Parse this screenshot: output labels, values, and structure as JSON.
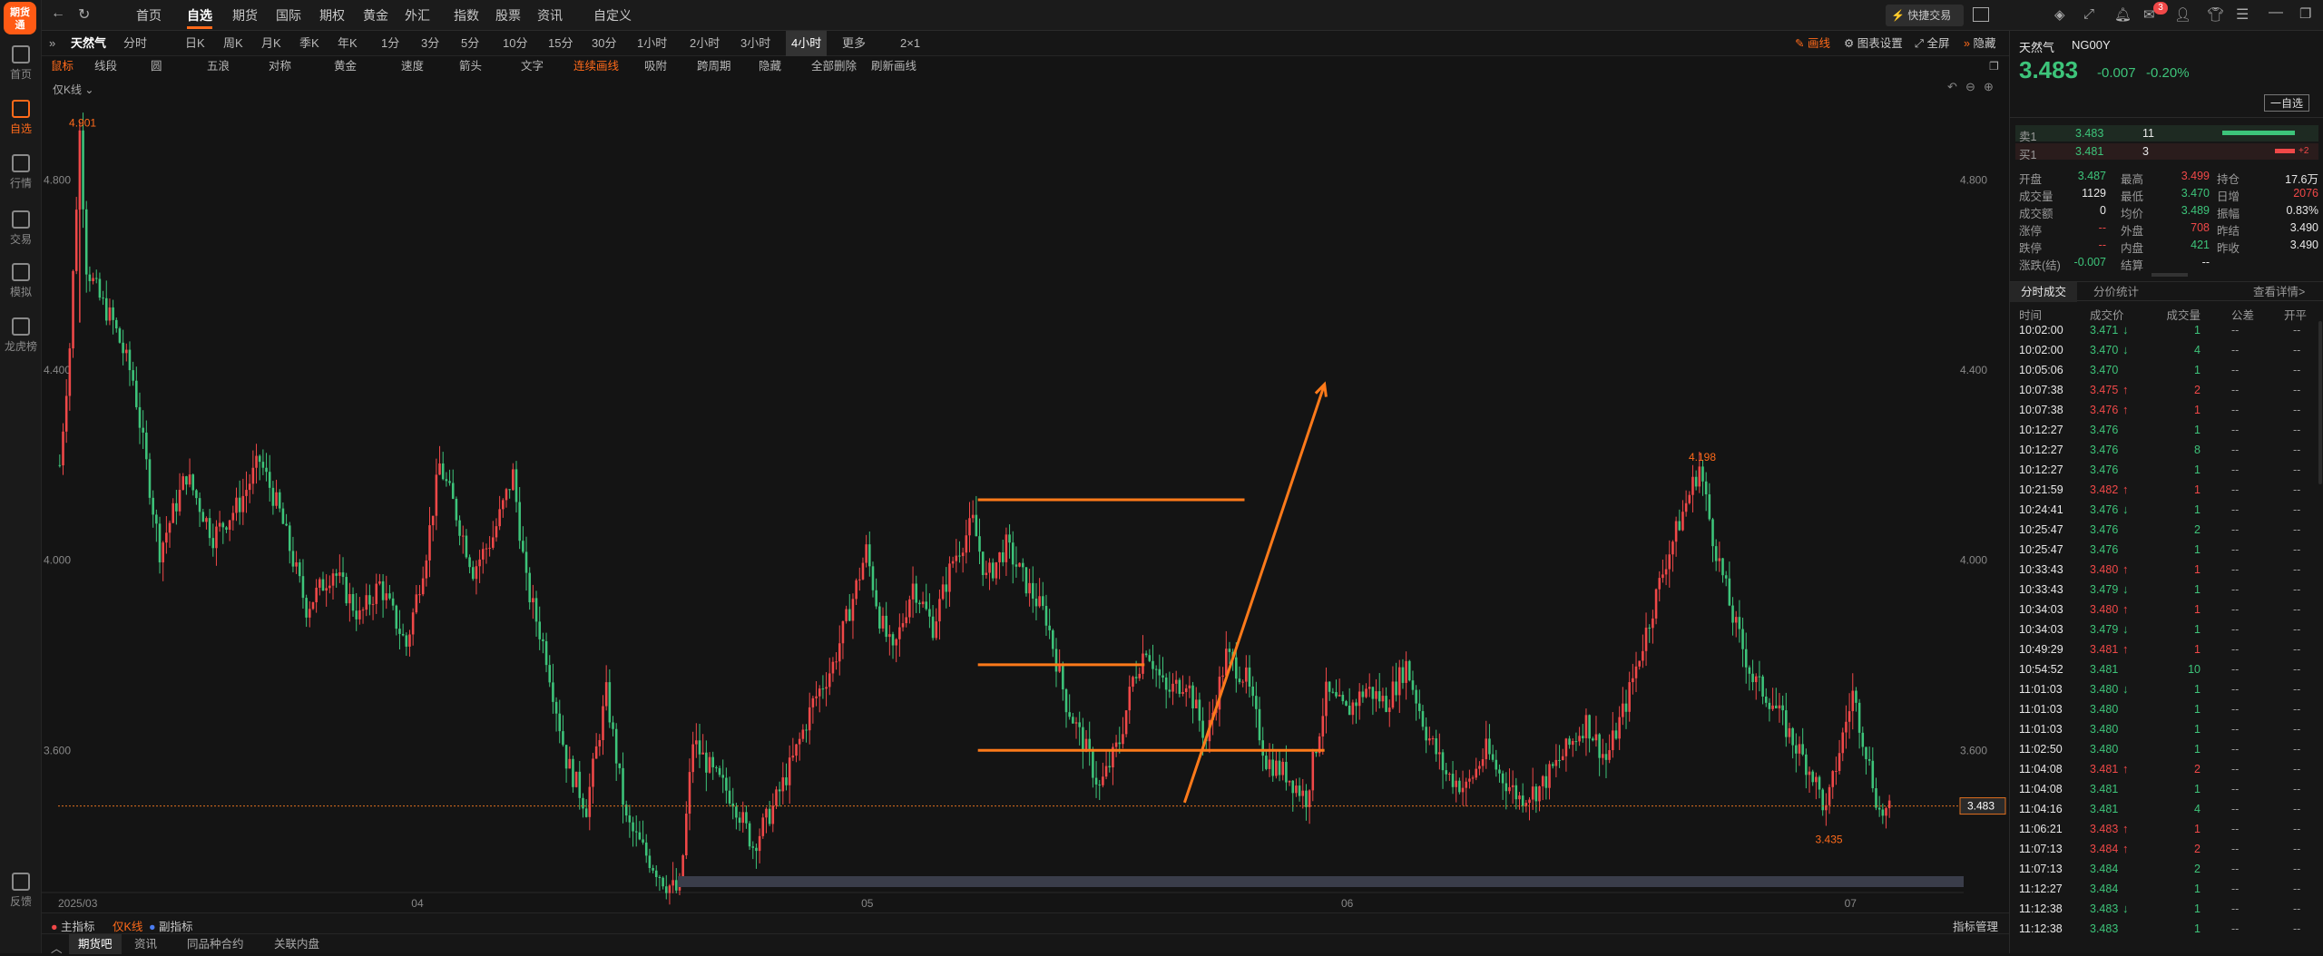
{
  "app": {
    "logo_text": "期货\n通"
  },
  "leftbar": [
    {
      "label": "首页",
      "icon": "grid-icon",
      "active": false
    },
    {
      "label": "自选",
      "icon": "briefcase-icon",
      "active": true
    },
    {
      "label": "行情",
      "icon": "chart-icon",
      "active": false
    },
    {
      "label": "交易",
      "icon": "yen-icon",
      "active": false
    },
    {
      "label": "模拟",
      "icon": "gamepad-icon",
      "active": false
    },
    {
      "label": "龙虎榜",
      "icon": "database-icon",
      "active": false
    },
    {
      "label": "反馈",
      "icon": "feedback-icon",
      "active": false
    }
  ],
  "nav": [
    "首页",
    "自选",
    "期货",
    "国际",
    "期权",
    "黄金",
    "外汇",
    "指数",
    "股票",
    "资讯",
    "自定义"
  ],
  "nav_active": 1,
  "toolbar_right": {
    "quick_trade": "快捷交易",
    "mail_badge": "3"
  },
  "symbol_tab": "天然气",
  "periods": [
    "分时",
    "日K",
    "周K",
    "月K",
    "季K",
    "年K",
    "1分",
    "3分",
    "5分",
    "10分",
    "15分",
    "30分",
    "1小时",
    "2小时",
    "3小时",
    "4小时",
    "更多",
    "2×1"
  ],
  "period_active": "4小时",
  "period_right": {
    "draw": "画线",
    "chart_settings": "图表设置",
    "fullscreen": "全屏",
    "hide": "隐藏"
  },
  "draw_tools": [
    "鼠标",
    "线段",
    "圆",
    "五浪",
    "对称",
    "黄金",
    "速度",
    "箭头",
    "文字",
    "连续画线",
    "吸附",
    "跨周期",
    "隐藏",
    "全部删除",
    "刷新画线"
  ],
  "chart_label": "仅K线",
  "chart_data": {
    "type": "candlestick",
    "ylim": [
      3.32,
      4.98
    ],
    "yticks": [
      "4.800",
      "4.400",
      "4.000",
      "3.600"
    ],
    "ytick_values": [
      4.8,
      4.4,
      4.0,
      3.6
    ],
    "xticks": [
      "2025/03",
      "04",
      "05",
      "06",
      "07"
    ],
    "last_price": "3.483",
    "last_value": 3.483,
    "annotations": [
      {
        "text": "4.901",
        "value": 4.901
      },
      {
        "text": "4.198",
        "value": 4.198
      },
      {
        "text": "3.435",
        "value": 3.435
      }
    ],
    "series_path": [
      [
        0,
        4.2
      ],
      [
        3,
        4.45
      ],
      [
        6,
        4.901
      ],
      [
        8,
        4.62
      ],
      [
        12,
        4.55
      ],
      [
        16,
        4.5
      ],
      [
        22,
        4.38
      ],
      [
        30,
        4.02
      ],
      [
        38,
        4.18
      ],
      [
        46,
        4.05
      ],
      [
        54,
        4.12
      ],
      [
        60,
        4.21
      ],
      [
        66,
        4.1
      ],
      [
        74,
        3.9
      ],
      [
        82,
        3.98
      ],
      [
        90,
        3.88
      ],
      [
        96,
        3.95
      ],
      [
        104,
        3.82
      ],
      [
        110,
        4.02
      ],
      [
        114,
        4.2
      ],
      [
        118,
        4.12
      ],
      [
        124,
        3.98
      ],
      [
        130,
        4.05
      ],
      [
        136,
        4.18
      ],
      [
        140,
        3.95
      ],
      [
        146,
        3.8
      ],
      [
        152,
        3.58
      ],
      [
        158,
        3.48
      ],
      [
        164,
        3.72
      ],
      [
        170,
        3.45
      ],
      [
        176,
        3.38
      ],
      [
        182,
        3.32
      ],
      [
        186,
        3.3
      ],
      [
        190,
        3.62
      ],
      [
        196,
        3.55
      ],
      [
        202,
        3.5
      ],
      [
        208,
        3.4
      ],
      [
        214,
        3.48
      ],
      [
        220,
        3.58
      ],
      [
        226,
        3.7
      ],
      [
        232,
        3.78
      ],
      [
        238,
        3.92
      ],
      [
        242,
        4.02
      ],
      [
        246,
        3.88
      ],
      [
        250,
        3.8
      ],
      [
        256,
        3.95
      ],
      [
        262,
        3.86
      ],
      [
        268,
        4.0
      ],
      [
        274,
        4.08
      ],
      [
        278,
        3.96
      ],
      [
        284,
        4.03
      ],
      [
        290,
        3.95
      ],
      [
        296,
        3.88
      ],
      [
        302,
        3.7
      ],
      [
        308,
        3.6
      ],
      [
        312,
        3.52
      ],
      [
        318,
        3.62
      ],
      [
        322,
        3.75
      ],
      [
        326,
        3.82
      ],
      [
        332,
        3.72
      ],
      [
        338,
        3.75
      ],
      [
        344,
        3.62
      ],
      [
        350,
        3.8
      ],
      [
        356,
        3.75
      ],
      [
        362,
        3.58
      ],
      [
        368,
        3.55
      ],
      [
        374,
        3.5
      ],
      [
        380,
        3.72
      ],
      [
        386,
        3.68
      ],
      [
        392,
        3.73
      ],
      [
        398,
        3.7
      ],
      [
        404,
        3.78
      ],
      [
        410,
        3.64
      ],
      [
        416,
        3.55
      ],
      [
        422,
        3.52
      ],
      [
        428,
        3.6
      ],
      [
        432,
        3.55
      ],
      [
        438,
        3.5
      ],
      [
        444,
        3.52
      ],
      [
        452,
        3.6
      ],
      [
        458,
        3.66
      ],
      [
        464,
        3.58
      ],
      [
        470,
        3.7
      ],
      [
        476,
        3.85
      ],
      [
        482,
        4.0
      ],
      [
        488,
        4.12
      ],
      [
        492,
        4.198
      ],
      [
        496,
        4.05
      ],
      [
        502,
        3.88
      ],
      [
        508,
        3.75
      ],
      [
        514,
        3.7
      ],
      [
        520,
        3.62
      ],
      [
        526,
        3.55
      ],
      [
        530,
        3.47
      ],
      [
        534,
        3.6
      ],
      [
        538,
        3.72
      ],
      [
        542,
        3.6
      ],
      [
        546,
        3.47
      ]
    ],
    "drawings": [
      {
        "type": "hline",
        "x1": 276,
        "x2": 356,
        "y": 4.127
      },
      {
        "type": "hline",
        "x1": 276,
        "x2": 326,
        "y": 3.78
      },
      {
        "type": "hline",
        "x1": 276,
        "x2": 380,
        "y": 3.6
      },
      {
        "type": "arrow",
        "x1": 338,
        "y1": 3.49,
        "x2": 380,
        "y2": 4.37
      }
    ],
    "x_count": 550,
    "xtick_positions": [
      0,
      106,
      241,
      385,
      536
    ]
  },
  "indicator_tabs": [
    "主指标",
    "仅K线",
    "副指标"
  ],
  "indicator_manage": "指标管理",
  "bottom_tabs": [
    "期货吧",
    "资讯",
    "同品种合约",
    "关联内盘"
  ],
  "quote": {
    "name": "天然气",
    "code": "NG00Y",
    "price": "3.483",
    "change": "-0.007",
    "change_pct": "-0.20%",
    "add_watch": "一自选",
    "sell_label": "卖1",
    "sell_price": "3.483",
    "sell_vol": "11",
    "buy_label": "买1",
    "buy_price": "3.481",
    "buy_vol": "3",
    "buy_delta": "+2",
    "stats": [
      [
        "开盘",
        "3.487",
        "最高",
        "3.499",
        "持仓",
        "17.6万"
      ],
      [
        "成交量",
        "1129",
        "最低",
        "3.470",
        "日增",
        "2076"
      ],
      [
        "成交额",
        "0",
        "均价",
        "3.489",
        "振幅",
        "0.83%"
      ],
      [
        "涨停",
        "--",
        "外盘",
        "708",
        "昨结",
        "3.490"
      ],
      [
        "跌停",
        "--",
        "内盘",
        "421",
        "昨收",
        "3.490"
      ],
      [
        "涨跌(结)",
        "-0.007",
        "结算",
        "--",
        "",
        ""
      ]
    ]
  },
  "trades_tabs": [
    "分时成交",
    "分价统计"
  ],
  "trades_detail": "查看详情>",
  "trades_headers": [
    "时间",
    "成交价",
    "成交量",
    "公差",
    "开平"
  ],
  "trades": [
    [
      "10:02:00",
      "3.471",
      "↓",
      "1"
    ],
    [
      "10:02:00",
      "3.470",
      "↓",
      "4"
    ],
    [
      "10:05:06",
      "3.470",
      "",
      "1"
    ],
    [
      "10:07:38",
      "3.475",
      "↑",
      "2"
    ],
    [
      "10:07:38",
      "3.476",
      "↑",
      "1"
    ],
    [
      "10:12:27",
      "3.476",
      "",
      "1"
    ],
    [
      "10:12:27",
      "3.476",
      "",
      "8"
    ],
    [
      "10:12:27",
      "3.476",
      "",
      "1"
    ],
    [
      "10:21:59",
      "3.482",
      "↑",
      "1"
    ],
    [
      "10:24:41",
      "3.476",
      "↓",
      "1"
    ],
    [
      "10:25:47",
      "3.476",
      "",
      "2"
    ],
    [
      "10:25:47",
      "3.476",
      "",
      "1"
    ],
    [
      "10:33:43",
      "3.480",
      "↑",
      "1"
    ],
    [
      "10:33:43",
      "3.479",
      "↓",
      "1"
    ],
    [
      "10:34:03",
      "3.480",
      "↑",
      "1"
    ],
    [
      "10:34:03",
      "3.479",
      "↓",
      "1"
    ],
    [
      "10:49:29",
      "3.481",
      "↑",
      "1"
    ],
    [
      "10:54:52",
      "3.481",
      "",
      "10"
    ],
    [
      "11:01:03",
      "3.480",
      "↓",
      "1"
    ],
    [
      "11:01:03",
      "3.480",
      "",
      "1"
    ],
    [
      "11:01:03",
      "3.480",
      "",
      "1"
    ],
    [
      "11:02:50",
      "3.480",
      "",
      "1"
    ],
    [
      "11:04:08",
      "3.481",
      "↑",
      "2"
    ],
    [
      "11:04:08",
      "3.481",
      "",
      "1"
    ],
    [
      "11:04:16",
      "3.481",
      "",
      "4"
    ],
    [
      "11:06:21",
      "3.483",
      "↑",
      "1"
    ],
    [
      "11:07:13",
      "3.484",
      "↑",
      "2"
    ],
    [
      "11:07:13",
      "3.484",
      "",
      "2"
    ],
    [
      "11:12:27",
      "3.484",
      "",
      "1"
    ],
    [
      "11:12:38",
      "3.483",
      "↓",
      "1"
    ],
    [
      "11:12:38",
      "3.483",
      "",
      "1"
    ]
  ],
  "colors": {
    "up": "#f04848",
    "down": "#3dc47a",
    "accent": "#ff6a1a"
  }
}
